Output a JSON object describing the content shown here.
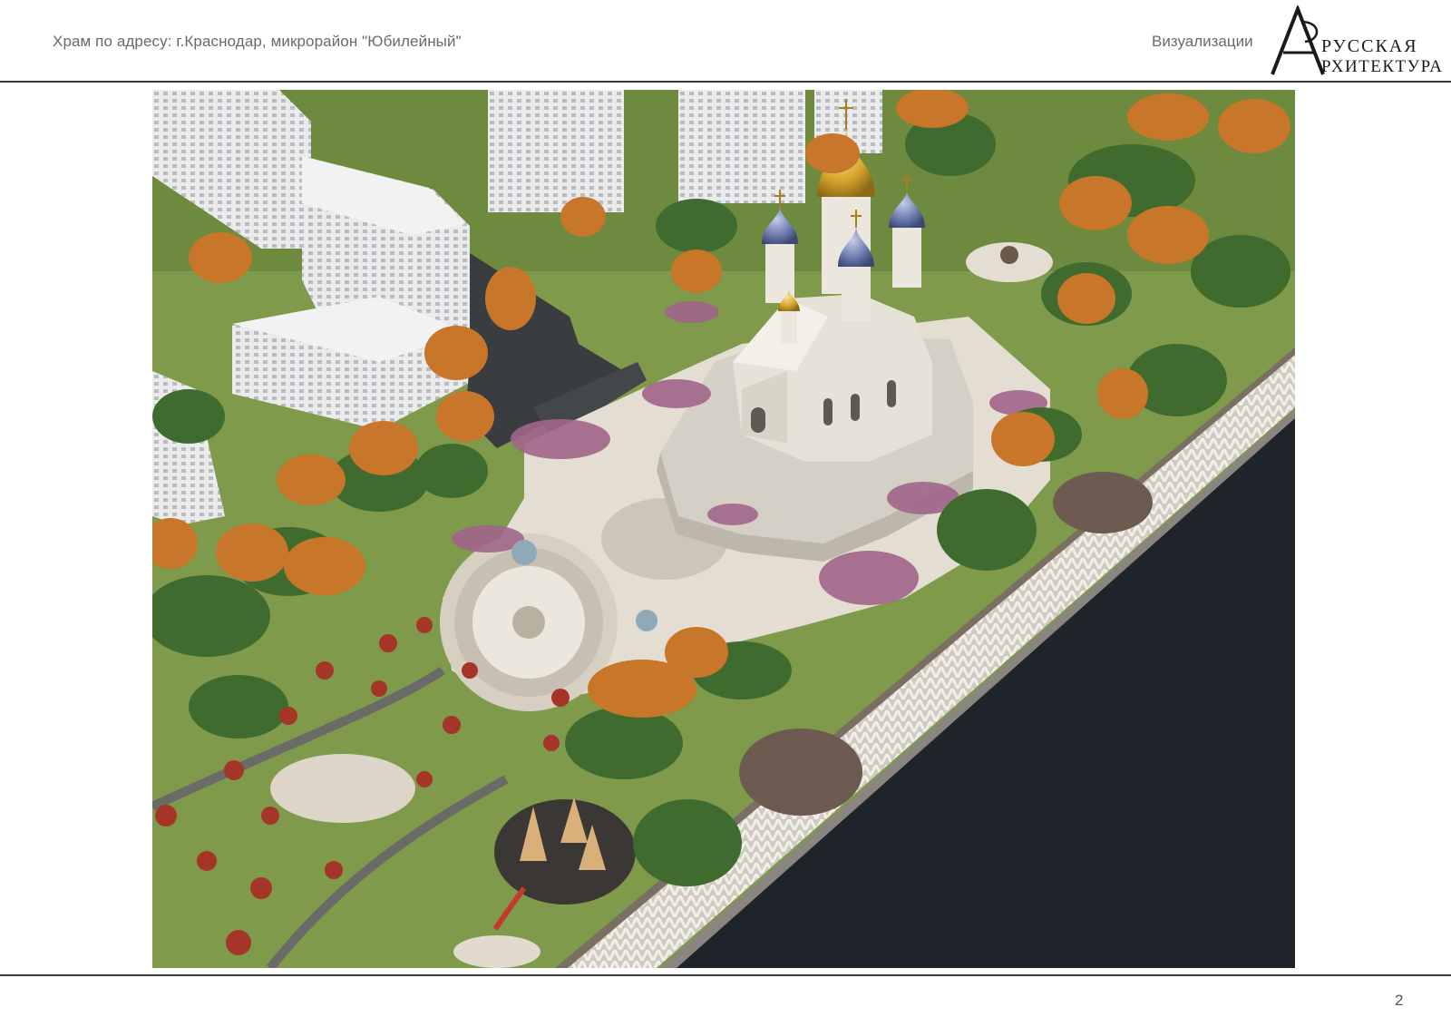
{
  "header": {
    "title": "Храм по адресу: г.Краснодар, микрорайон \"Юбилейный\"",
    "section": "Визуализации"
  },
  "logo": {
    "line1": "РУССКАЯ",
    "line2": "РХИТЕКТУРА"
  },
  "footer": {
    "page_number": "2"
  },
  "colors": {
    "rule": "#3a3a3a",
    "river": "#1f242b",
    "lawn": "#7e9a4a",
    "plaza": "#e3ddd2",
    "church_walls": "#e6e2d8",
    "main_dome": "#d5a52c",
    "side_domes": "#6f7eb0",
    "autumn_trees": "#c8762a"
  }
}
